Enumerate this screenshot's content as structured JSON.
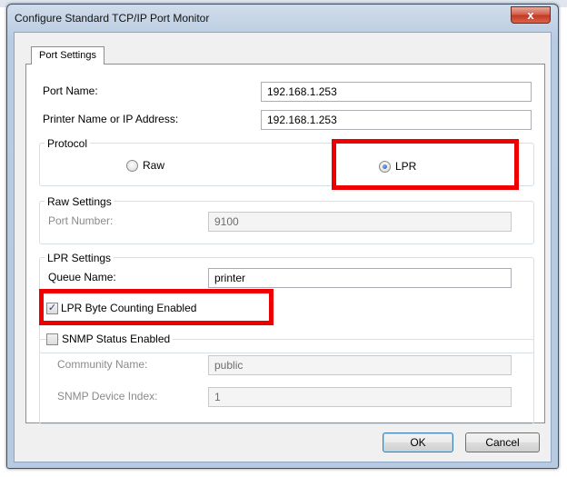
{
  "window": {
    "title": "Configure Standard TCP/IP Port Monitor",
    "close_glyph": "x"
  },
  "tabs": [
    {
      "label": "Port Settings"
    }
  ],
  "port_name": {
    "label": "Port Name:",
    "value": "192.168.1.253"
  },
  "printer_name": {
    "label": "Printer Name or IP Address:",
    "value": "192.168.1.253"
  },
  "protocol": {
    "legend": "Protocol",
    "raw_label": "Raw",
    "lpr_label": "LPR",
    "selected": "LPR"
  },
  "raw_settings": {
    "legend": "Raw Settings",
    "port_number_label": "Port Number:",
    "port_number_value": "9100"
  },
  "lpr_settings": {
    "legend": "LPR Settings",
    "queue_name_label": "Queue Name:",
    "queue_name_value": "printer",
    "byte_counting_label": "LPR Byte Counting Enabled",
    "byte_counting_checked": true
  },
  "snmp": {
    "label": "SNMP Status Enabled",
    "checked": false,
    "community_label": "Community Name:",
    "community_value": "public",
    "device_index_label": "SNMP Device Index:",
    "device_index_value": "1"
  },
  "buttons": {
    "ok": "OK",
    "cancel": "Cancel"
  },
  "colors": {
    "highlight": "#ee0000",
    "title_bar": "#b9cbe0",
    "close_button": "#c3371f"
  }
}
